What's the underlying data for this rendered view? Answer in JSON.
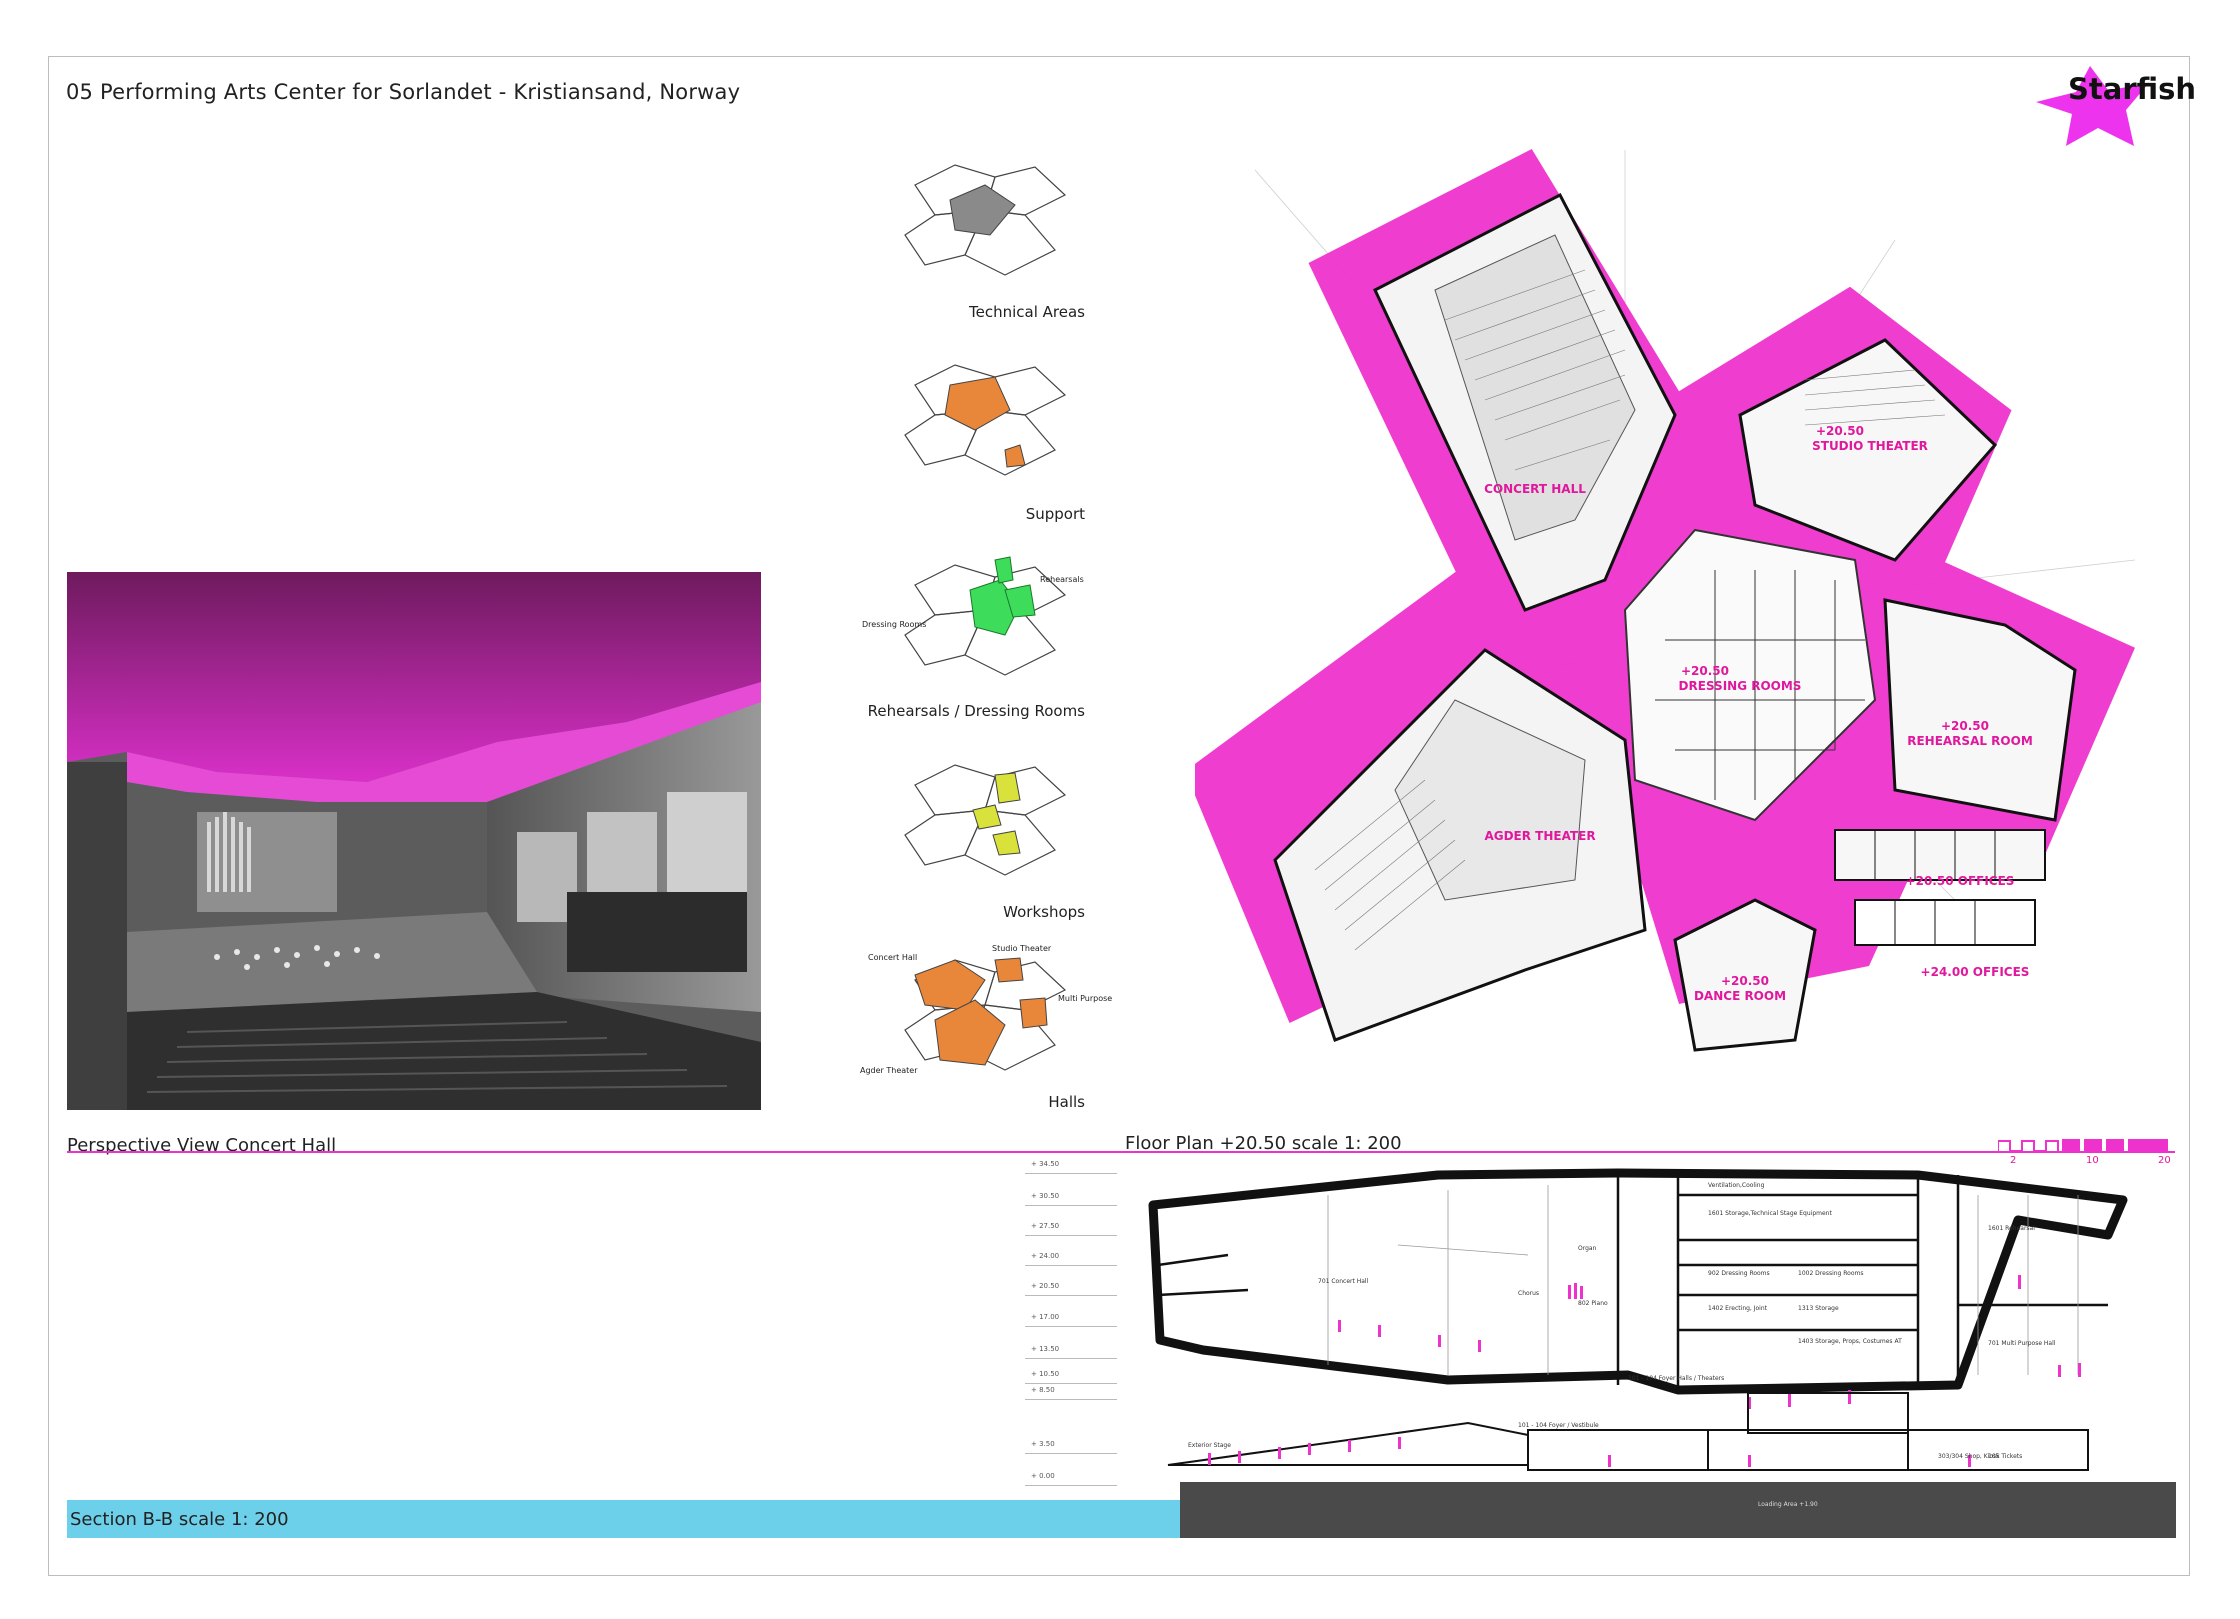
{
  "title": "05 Performing Arts Center for Sorlandet - Kristiansand, Norway",
  "logo": {
    "text": "Starfish",
    "color": "#ee33ee"
  },
  "diagrams": [
    {
      "caption": "Technical Areas",
      "color": "#8a8a8a"
    },
    {
      "caption": "Support",
      "color": "#e8863a"
    },
    {
      "caption": "Rehearsals / Dressing Rooms",
      "color": "#3ddc5a",
      "labels": [
        "Rehearsals",
        "Dressing Rooms"
      ]
    },
    {
      "caption": "Workshops",
      "color": "#d8e23a"
    },
    {
      "caption": "Halls",
      "color": "#e8863a",
      "labels": [
        "Concert Hall",
        "Studio Theater",
        "Multi Purpose",
        "Agder Theater"
      ]
    }
  ],
  "captions": {
    "perspective": "Perspective View Concert Hall",
    "floor_plan": "Floor Plan +20.50 scale 1: 200",
    "section": "Section B-B scale 1: 200"
  },
  "scale": {
    "labels": [
      "2",
      "10",
      "20"
    ]
  },
  "plan_rooms": {
    "concert_hall": "CONCERT HALL",
    "studio_level": "+20.50",
    "studio": "STUDIO THEATER",
    "dressing_level": "+20.50",
    "dressing": "DRESSING ROOMS",
    "rehearsal_level": "+20.50",
    "rehearsal": "REHEARSAL ROOM",
    "agder": "AGDER THEATER",
    "offices_2050": "+20.50 OFFICES",
    "offices_2400": "+24.00 OFFICES",
    "dance_level": "+20.50",
    "dance": "DANCE ROOM"
  },
  "elevations": [
    "+ 34.50",
    "+ 30.50",
    "+ 27.50",
    "+ 24.00",
    "+ 20.50",
    "+ 17.00",
    "+ 13.50",
    "+ 10.50",
    "+ 8.50",
    "+ 3.50",
    "+ 0.00"
  ],
  "section_labels": {
    "ventilation": "Ventilation,Cooling",
    "storage_tech": "1601 Storage,Technical Stage Equipment",
    "rehearsal": "1601 Rehearsal",
    "concert_hall": "701 Concert Hall",
    "organ": "Organ",
    "chorus": "Chorus",
    "piano": "802 Piano",
    "dressing_a": "902 Dressing Rooms",
    "dressing_b": "1002 Dressing Rooms",
    "erecting": "1402 Erecting, Joint",
    "storage": "1313 Storage",
    "storage_props": "1403 Storage, Props, Costumes AT",
    "multi": "701 Multi Purpose Hall",
    "foyer_theaters": "101 - 104 Foyer Halls / Theaters",
    "foyer_vestibule": "101 - 104 Foyer / Vestibule",
    "exterior_stage": "Exterior Stage",
    "shop": "303/304 Shop, Kiosk",
    "tickets": "105 Tickets",
    "loading": "Loading Area +1.90"
  }
}
